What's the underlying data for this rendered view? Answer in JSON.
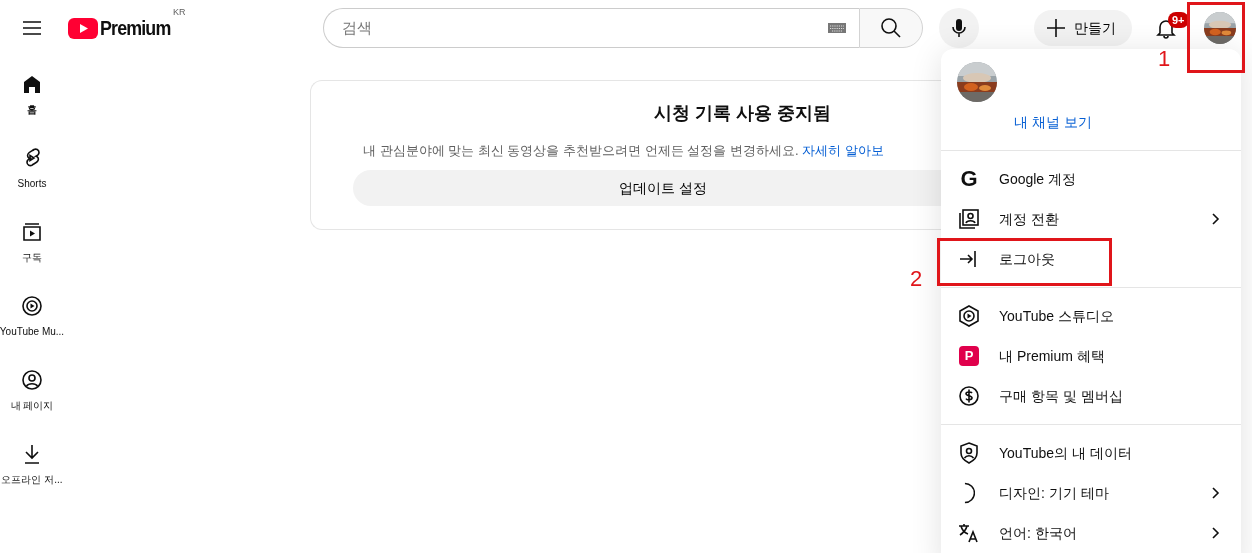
{
  "header": {
    "logo_text": "Premium",
    "region": "KR",
    "search": {
      "placeholder": "검색"
    },
    "create_label": "만들기",
    "notification_count": "9+"
  },
  "sidebar": {
    "items": [
      {
        "label": "홈",
        "selected": true
      },
      {
        "label": "Shorts",
        "selected": false
      },
      {
        "label": "구독",
        "selected": false
      },
      {
        "label": "YouTube Mu...",
        "selected": false
      },
      {
        "label": "내 페이지",
        "selected": false
      },
      {
        "label": "오프라인 저...",
        "selected": false
      }
    ]
  },
  "notice": {
    "title": "시청 기록 사용 중지됨",
    "text": "내 관심분야에 맞는 최신 동영상을 추천받으려면 언제든 설정을 변경하세요.",
    "link": "자세히 알아보",
    "button": "업데이트 설정"
  },
  "account_menu": {
    "channel_link": "내 채널 보기",
    "sections": [
      {
        "items": [
          {
            "label": "Google 계정",
            "icon_text": "G",
            "submenu": false
          },
          {
            "label": "계정 전환",
            "submenu": true
          },
          {
            "label": "로그아웃",
            "submenu": false
          }
        ]
      },
      {
        "items": [
          {
            "label": "YouTube 스튜디오",
            "submenu": false
          },
          {
            "label": "내 Premium 혜택",
            "icon_text": "P",
            "submenu": false
          },
          {
            "label": "구매 항목 및 멤버십",
            "submenu": false
          }
        ]
      },
      {
        "items": [
          {
            "label": "YouTube의 내 데이터",
            "submenu": false
          },
          {
            "label": "디자인: 기기 테마",
            "submenu": true
          },
          {
            "label": "언어: 한국어",
            "submenu": true
          }
        ]
      }
    ]
  },
  "annotations": [
    {
      "label": "1"
    },
    {
      "label": "2"
    }
  ]
}
